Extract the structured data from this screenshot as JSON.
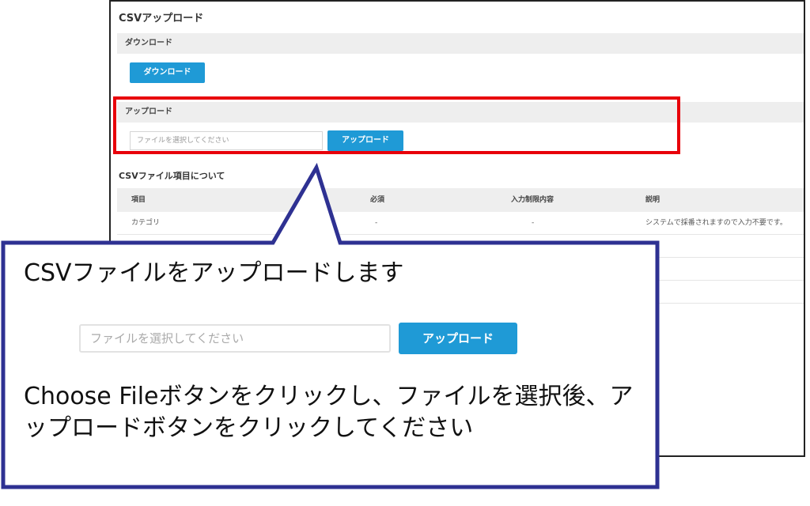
{
  "page": {
    "title": "CSVアップロード",
    "download_section": {
      "label": "ダウンロード",
      "button": "ダウンロード"
    },
    "upload_section": {
      "label": "アップロード",
      "file_placeholder": "ファイルを選択してください",
      "button": "アップロード"
    },
    "fields_section": {
      "title": "CSVファイル項目について",
      "columns": [
        "項目",
        "必須",
        "入力制限内容",
        "説明"
      ],
      "rows": [
        [
          "カテゴリ",
          "-",
          "-",
          "システムで採番されますので入力不要です。"
        ]
      ]
    }
  },
  "callout": {
    "title": "CSVファイルをアップロードします",
    "file_placeholder": "ファイルを選択してください",
    "button": "アップロード",
    "body": "Choose Fileボタンをクリックし、ファイルを選択後、アップロードボタンをクリックしてください"
  },
  "colors": {
    "accent": "#1f9ad6",
    "highlight": "#e8000a",
    "callout_border": "#2e3192"
  }
}
